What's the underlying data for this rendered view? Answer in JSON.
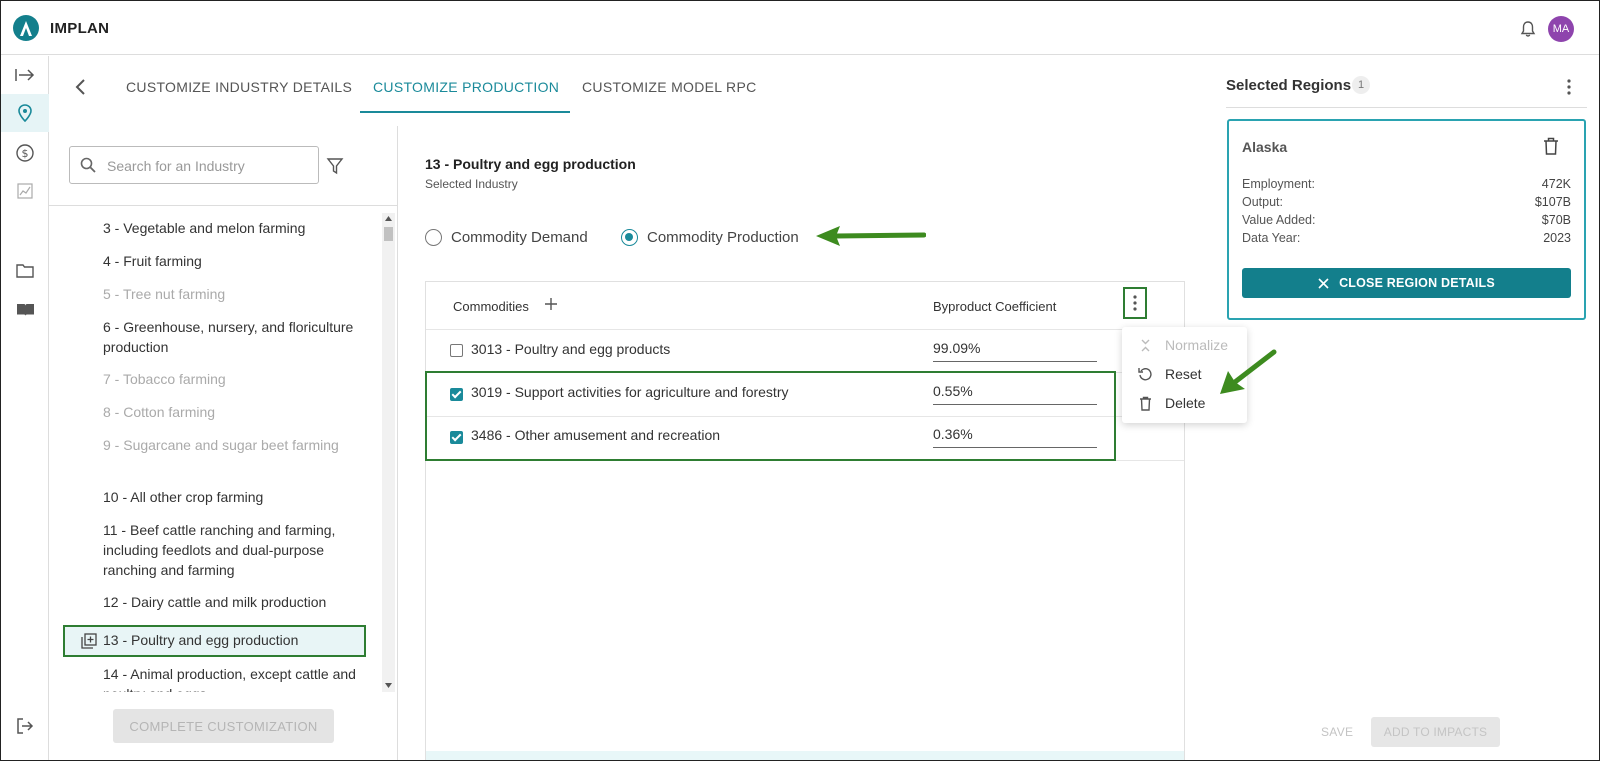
{
  "app": {
    "brand": "IMPLAN",
    "user_initials": "MA"
  },
  "tabs": [
    {
      "label": "CUSTOMIZE INDUSTRY DETAILS"
    },
    {
      "label": "CUSTOMIZE PRODUCTION"
    },
    {
      "label": "CUSTOMIZE MODEL RPC"
    }
  ],
  "search": {
    "placeholder": "Search for an Industry"
  },
  "industries": [
    {
      "label": "3 - Vegetable and melon farming",
      "disabled": false
    },
    {
      "label": "4 - Fruit farming",
      "disabled": false
    },
    {
      "label": "5 - Tree nut farming",
      "disabled": true
    },
    {
      "label": "6 - Greenhouse, nursery, and floriculture production",
      "disabled": false
    },
    {
      "label": "7 - Tobacco farming",
      "disabled": true
    },
    {
      "label": "8 - Cotton farming",
      "disabled": true
    },
    {
      "label": "9 - Sugarcane and sugar beet farming",
      "disabled": true
    },
    {
      "label": "10 - All other crop farming",
      "disabled": false
    },
    {
      "label": "11 - Beef cattle ranching and farming, including feedlots and dual-purpose ranching and farming",
      "disabled": false
    },
    {
      "label": "12 - Dairy cattle and milk production",
      "disabled": false
    },
    {
      "label": "13 - Poultry and egg production",
      "disabled": false,
      "selected": true
    },
    {
      "label": "14 - Animal production, except cattle and poultry and eggs",
      "disabled": false
    }
  ],
  "complete_button": "COMPLETE CUSTOMIZATION",
  "industry_detail": {
    "title": "13 - Poultry and egg production",
    "subtitle": "Selected Industry"
  },
  "radio": {
    "demand_label": "Commodity Demand",
    "production_label": "Commodity Production",
    "selected": "production"
  },
  "commodities_table": {
    "col_commodities": "Commodities",
    "col_coefficient": "Byproduct Coefficient",
    "rows": [
      {
        "label": "3013 - Poultry and egg products",
        "coefficient": "99.09%",
        "checked": false
      },
      {
        "label": "3019 - Support activities for agriculture and forestry",
        "coefficient": "0.55%",
        "checked": true
      },
      {
        "label": "3486 - Other amusement and recreation",
        "coefficient": "0.36%",
        "checked": true
      }
    ]
  },
  "context_menu": {
    "normalize": "Normalize",
    "reset": "Reset",
    "delete": "Delete"
  },
  "selected_regions": {
    "title": "Selected Regions",
    "count": "1",
    "region": {
      "name": "Alaska",
      "stats": [
        {
          "label": "Employment:",
          "value": "472K"
        },
        {
          "label": "Output:",
          "value": "$107B"
        },
        {
          "label": "Value Added:",
          "value": "$70B"
        },
        {
          "label": "Data Year:",
          "value": "2023"
        }
      ],
      "close_button": "CLOSE REGION DETAILS"
    }
  },
  "footer": {
    "save": "SAVE",
    "add_to_impacts": "ADD TO IMPACTS"
  },
  "colors": {
    "accent": "#1a8a9a",
    "highlight": "#2e7d32",
    "arrow": "#3d8b1f",
    "avatar": "#8e44ad"
  }
}
